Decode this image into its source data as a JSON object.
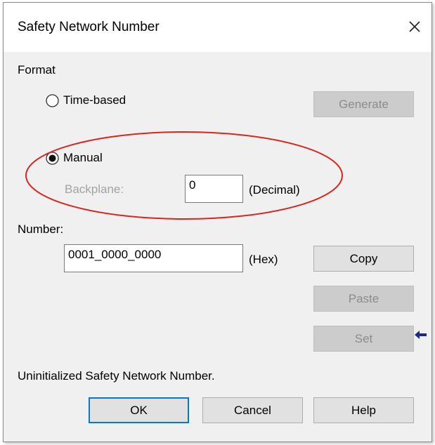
{
  "dialog": {
    "title": "Safety Network Number",
    "close_glyph": "✕"
  },
  "format": {
    "label": "Format",
    "time_based": {
      "label": "Time-based",
      "selected": false
    },
    "manual": {
      "label": "Manual",
      "selected": true
    },
    "backplane_label": "Backplane:",
    "backplane_value": "0",
    "backplane_unit": "(Decimal)",
    "generate_button": {
      "label": "Generate",
      "enabled": false
    }
  },
  "number": {
    "label": "Number:",
    "value": "0001_0000_0000",
    "unit": "(Hex)"
  },
  "buttons": {
    "copy": {
      "label": "Copy",
      "enabled": true
    },
    "paste": {
      "label": "Paste",
      "enabled": false
    },
    "set": {
      "label": "Set",
      "enabled": false
    },
    "ok": {
      "label": "OK",
      "default": true
    },
    "cancel": {
      "label": "Cancel"
    },
    "help": {
      "label": "Help"
    }
  },
  "status_text": "Uninitialized Safety Network Number.",
  "annotations": {
    "highlight_color": "#d9251c",
    "arrow_color": "#1a2a8c",
    "arrow_icon": "left-arrow-icon"
  }
}
